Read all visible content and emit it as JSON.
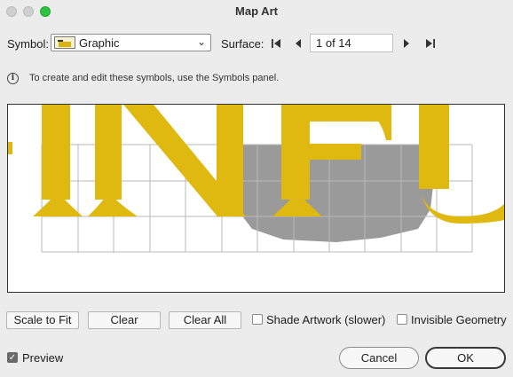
{
  "window": {
    "title": "Map Art"
  },
  "symbol": {
    "label": "Symbol:",
    "selected": "Graphic"
  },
  "surface": {
    "label": "Surface:",
    "value": "1 of 14"
  },
  "info": {
    "text": "To create and edit these symbols, use the Symbols panel."
  },
  "buttons": {
    "scale_to_fit": "Scale to Fit",
    "clear": "Clear",
    "clear_all": "Clear All",
    "cancel": "Cancel",
    "ok": "OK"
  },
  "options": {
    "shade_artwork": {
      "label": "Shade Artwork (slower)",
      "checked": false
    },
    "invisible_geometry": {
      "label": "Invisible Geometry",
      "checked": false
    },
    "preview": {
      "label": "Preview",
      "checked": true
    }
  },
  "art": {
    "letters": "INFU",
    "letter_color": "#dfb910",
    "shade_color": "#9a9a9a",
    "grid_color": "#b9b9b9"
  }
}
